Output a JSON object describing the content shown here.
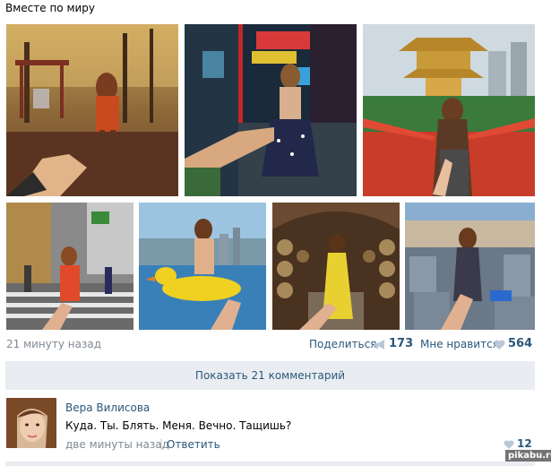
{
  "post": {
    "title": "Вместе по миру",
    "time": "21 минуту назад",
    "share_label": "Поделиться",
    "share_count": "173",
    "like_label": "Мне нравится",
    "like_count": "564",
    "show_comments": "Показать 21 комментарий"
  },
  "photos": [
    {
      "name": "photo-playground-autumn"
    },
    {
      "name": "photo-city-neon-night"
    },
    {
      "name": "photo-chinese-pavilion-bridge"
    },
    {
      "name": "photo-city-crosswalk"
    },
    {
      "name": "photo-beach-duck-float"
    },
    {
      "name": "photo-wine-cellar"
    },
    {
      "name": "photo-memorial-stones"
    }
  ],
  "comment": {
    "author": "Вера Вилисова",
    "text": "Куда. Ты. Блять. Меня. Вечно. Тащишь?",
    "time": "две минуты назад",
    "separator": "|",
    "reply_label": "Ответить",
    "likes": "12"
  },
  "watermark": "pikabu.ru",
  "colors": {
    "link": "#2b587a",
    "muted": "#808a94",
    "button_bg": "#e9edf1",
    "heart": "#b9c7d6"
  }
}
